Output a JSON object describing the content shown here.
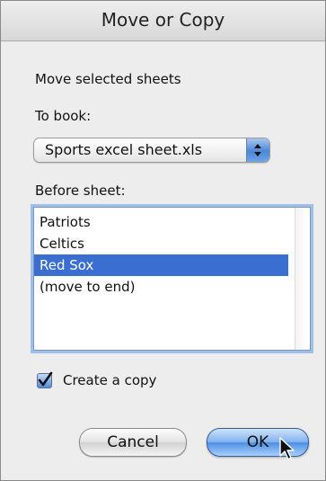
{
  "dialog": {
    "title": "Move or Copy",
    "subtitle": "Move selected sheets",
    "to_book_label": "To book:",
    "to_book_value": "Sports excel sheet.xls",
    "before_sheet_label": "Before sheet:",
    "sheets": [
      "Patriots",
      "Celtics",
      "Red Sox",
      "(move to end)"
    ],
    "selected_sheet": "Red Sox",
    "create_copy_label": "Create a copy",
    "create_copy_checked": true,
    "cancel_label": "Cancel",
    "ok_label": "OK"
  },
  "colors": {
    "selection": "#3a6fd1",
    "accent": "#4b87d6"
  },
  "icons": {
    "popup": "up-down-chevron-icon",
    "checkbox": "checkmark-icon",
    "cursor": "arrow-cursor-icon"
  }
}
